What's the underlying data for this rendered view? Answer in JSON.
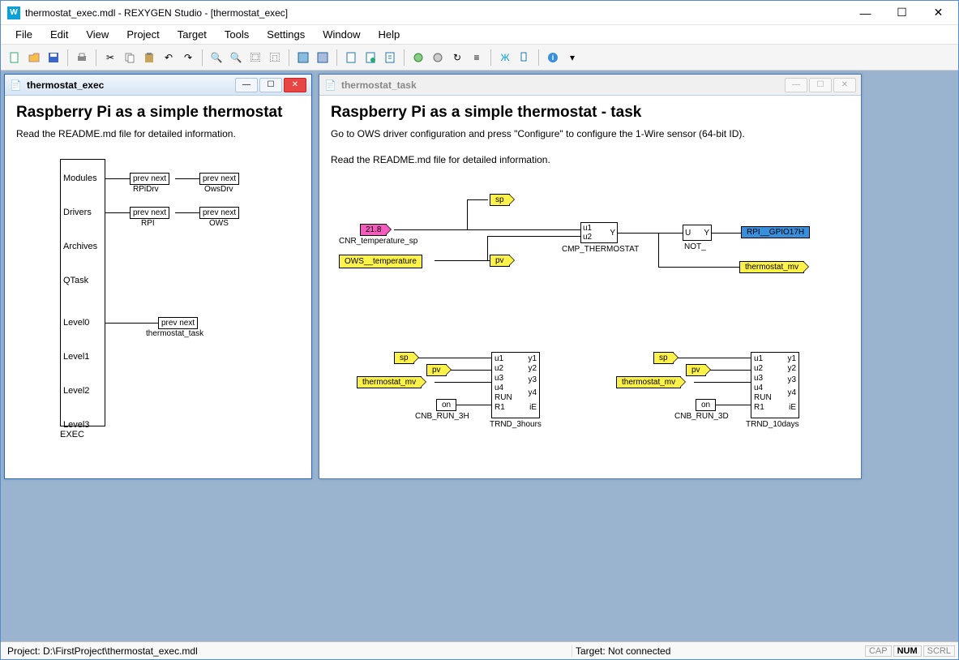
{
  "window": {
    "title": "thermostat_exec.mdl - REXYGEN Studio - [thermostat_exec]",
    "app_icon_text": "W"
  },
  "menu": [
    "File",
    "Edit",
    "View",
    "Project",
    "Target",
    "Tools",
    "Settings",
    "Window",
    "Help"
  ],
  "toolbar_groups": [
    [
      "new",
      "open",
      "save"
    ],
    [
      "print"
    ],
    [
      "cut",
      "copy",
      "paste",
      "undo",
      "redo"
    ],
    [
      "zoomin",
      "zoomout",
      "zoomfit",
      "zoomsel"
    ],
    [
      "db1",
      "db2"
    ],
    [
      "sheet1",
      "sheet2",
      "sheet3"
    ],
    [
      "proc1",
      "proc2",
      "proc3",
      "list"
    ],
    [
      "net1",
      "net2"
    ],
    [
      "help",
      "drop"
    ]
  ],
  "child1": {
    "title": "thermostat_exec",
    "heading": "Raspberry Pi as a simple thermostat",
    "sub": "Read the README.md file for detailed information.",
    "exec_label": "EXEC",
    "ports": [
      "Modules",
      "Drivers",
      "Archives",
      "QTask",
      "Level0",
      "Level1",
      "Level2",
      "Level3"
    ],
    "modules": [
      {
        "text": "prev  next",
        "label": "RPiDrv"
      },
      {
        "text": "prev  next",
        "label": "OwsDrv"
      }
    ],
    "drivers": [
      {
        "text": "prev  next",
        "label": "RPI"
      },
      {
        "text": "prev  next",
        "label": "OWS"
      }
    ],
    "level0": {
      "text": "prev  next",
      "label": "thermostat_task"
    }
  },
  "child2": {
    "title": "thermostat_task",
    "heading": "Raspberry Pi as a simple thermostat - task",
    "info1": "Go to OWS driver configuration and press \"Configure\" to configure the 1-Wire sensor (64-bit ID).",
    "info2": "Read the README.md file for detailed information.",
    "temp_value": "21.8",
    "cnr_label": "CNR_temperature_sp",
    "ows_label": "OWS__temperature",
    "sp_label": "sp",
    "pv_label": "pv",
    "cmp_u1": "u1",
    "cmp_u2": "u2",
    "cmp_y": "Y",
    "cmp_label": "CMP_THERMOSTAT",
    "not_u": "U",
    "not_y": "Y",
    "not_label": "NOT_",
    "gpio_label": "RPI__GPIO17H",
    "tmv_label": "thermostat_mv",
    "trnd1": {
      "sp": "sp",
      "pv": "pv",
      "tmv": "thermostat_mv",
      "on": "on",
      "cnb": "CNB_RUN_3H",
      "u1": "u1",
      "u2": "u2",
      "u3": "u3",
      "u4": "u4",
      "run": "RUN",
      "r1": "R1",
      "y1": "y1",
      "y2": "y2",
      "y3": "y3",
      "y4": "y4",
      "ie": "iE",
      "label": "TRND_3hours"
    },
    "trnd2": {
      "sp": "sp",
      "pv": "pv",
      "tmv": "thermostat_mv",
      "on": "on",
      "cnb": "CNB_RUN_3D",
      "u1": "u1",
      "u2": "u2",
      "u3": "u3",
      "u4": "u4",
      "run": "RUN",
      "r1": "R1",
      "y1": "y1",
      "y2": "y2",
      "y3": "y3",
      "y4": "y4",
      "ie": "iE",
      "label": "TRND_10days"
    }
  },
  "status": {
    "project": "Project: D:\\FirstProject\\thermostat_exec.mdl",
    "target": "Target: Not connected",
    "cap": "CAP",
    "num": "NUM",
    "scrl": "SCRL"
  }
}
